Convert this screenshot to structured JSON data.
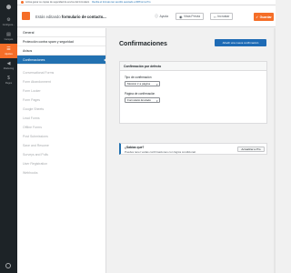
{
  "admin_menu": [
    {
      "icon": "⬤",
      "label": "",
      "icon_name": "wordpress-logo-icon",
      "active": false
    },
    {
      "icon": "⚙",
      "label": "Configura...",
      "icon_name": "settings-icon",
      "active": false
    },
    {
      "icon": "▤",
      "label": "Campos",
      "icon_name": "fields-icon",
      "active": false
    },
    {
      "icon": "☰",
      "label": "Ajustes",
      "icon_name": "sliders-icon",
      "active": true
    },
    {
      "icon": "◀",
      "label": "Marketing",
      "icon_name": "megaphone-icon",
      "active": false
    },
    {
      "icon": "$",
      "label": "Pagos",
      "icon_name": "dollar-icon",
      "active": false
    }
  ],
  "notice": {
    "text": "Activa ganar su copias de seguridad de envíos del formulario",
    "link": "Reciba el formato tan sencillo asociado a WPForms Pro"
  },
  "header": {
    "editing_prefix": "Estás editando",
    "form_name": "formulario de contacto...",
    "help": "Ayuda",
    "preview": "Vista Previa",
    "embed": "Incrustar",
    "save": "Guardar"
  },
  "settings_nav": {
    "items": [
      "General",
      "Protección contra spam y seguridad",
      "Avisos",
      "Confirmaciones"
    ],
    "active_index": 3,
    "pro_items": [
      "Conversational Forms",
      "Form Abandonment",
      "Form Locker",
      "Form Pages",
      "Google Sheets",
      "Lead Forms",
      "Offline Forms",
      "Post Submissions",
      "Save and Resume",
      "Surveys and Polls",
      "User Registration",
      "Webhooks"
    ]
  },
  "main": {
    "title": "Confirmaciones",
    "add_button": "Añadir una nueva confirmación",
    "panel_title": "Confirmación por defecto",
    "type_label": "Tipo de confirmación",
    "type_value": "Mostrar ir a página",
    "page_label": "Página de confirmación",
    "page_value": "Formulario Enviado"
  },
  "promo": {
    "title": "¿Sabías que?",
    "text": "Puedes tener varias confirmaciones con lógica condicional.",
    "button": "Actualizar a Pro"
  },
  "colors": {
    "accent": "#f56e28",
    "primary": "#2271b1",
    "admin_bg": "#1d2327"
  }
}
